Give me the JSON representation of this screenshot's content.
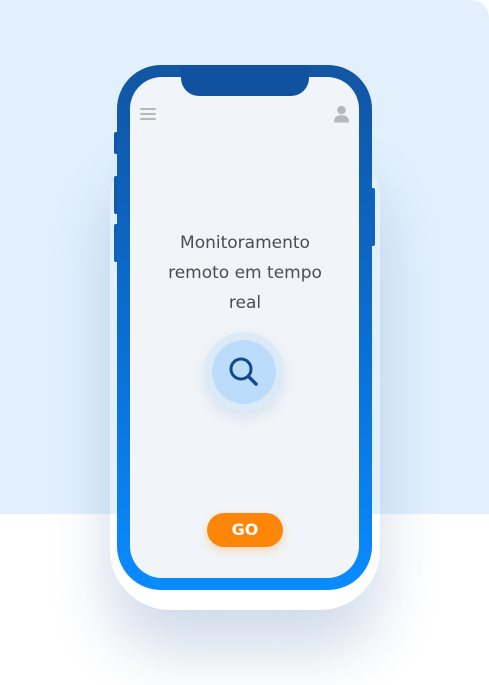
{
  "screen": {
    "title": "Monitoramento remoto em tempo real",
    "go_label": "GO"
  },
  "icons": {
    "menu": "hamburger-menu-icon",
    "user": "user-profile-icon",
    "search": "magnifier-search-icon"
  },
  "colors": {
    "background_panel": "#e2f0fd",
    "phone_frame_top": "#1255a3",
    "phone_frame_bottom": "#0a8bff",
    "screen": "#f1f5f9",
    "search_circle": "#bcdcfb",
    "search_icon": "#0f4a8f",
    "go_button": "#fd8609",
    "title_text": "#4a4c50"
  }
}
